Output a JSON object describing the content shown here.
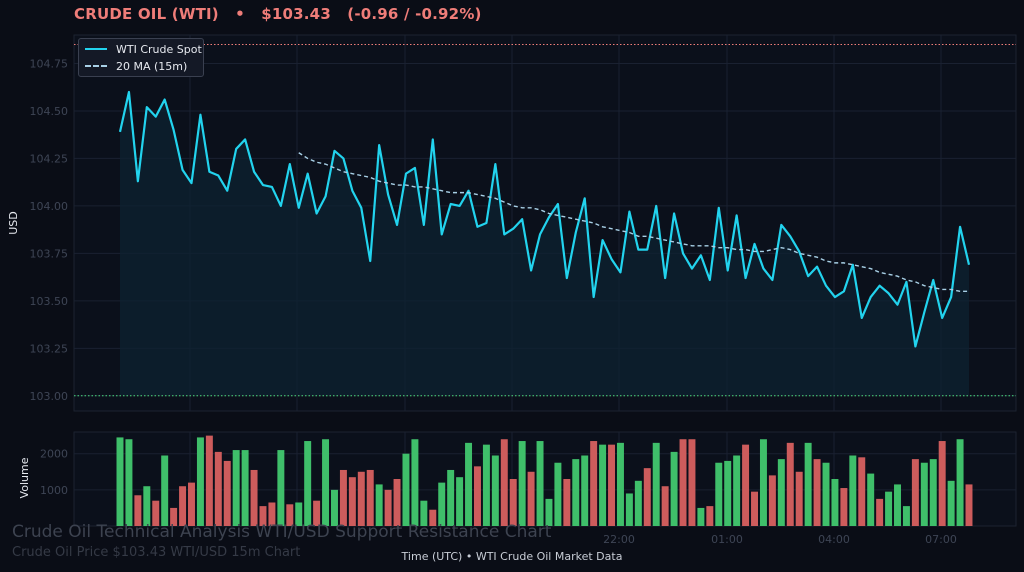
{
  "header": {
    "name": "CRUDE OIL (WTI)",
    "sep": "•",
    "price": "$103.43",
    "change": "(-0.96 / -0.92%)"
  },
  "watermark": {
    "title": "Crude Oil Technical Analysis WTI/USD Support Resistance Chart",
    "subtitle": "Crude Oil Price $103.43 WTI/USD 15m Chart"
  },
  "footer": {
    "text": "Time (UTC)  •  WTI Crude Oil Market Data"
  },
  "legend": {
    "spot": "WTI Crude Spot",
    "ma": "20 MA (15m)"
  },
  "colors": {
    "background": "#0a0d16",
    "price_line": "#22d3ee",
    "ma_line": "#a8d0e6",
    "resistance": "#ef7d79",
    "support": "#4ade80",
    "vol_up": "#3fbf6a",
    "vol_down": "#cd5c5c"
  },
  "chart_data": [
    {
      "type": "line",
      "ylabel": "USD",
      "ylim": [
        102.92,
        104.9
      ],
      "yticks": [
        103.0,
        103.25,
        103.5,
        103.75,
        104.0,
        104.25,
        104.5,
        104.75
      ],
      "ytick_labels": [
        "103.00",
        "103.25",
        "103.50",
        "103.75",
        "104.00",
        "104.25",
        "104.50",
        "104.75"
      ],
      "xticks_labels": [
        "22:00",
        "01:00",
        "04:00",
        "07:00"
      ],
      "resistance": 104.85,
      "support": 103.0,
      "grid": true,
      "legend_position": "top-left",
      "series": [
        {
          "name": "WTI Crude Spot",
          "values": [
            104.39,
            104.6,
            104.13,
            104.52,
            104.47,
            104.56,
            104.4,
            104.19,
            104.12,
            104.48,
            104.18,
            104.16,
            104.08,
            104.3,
            104.35,
            104.18,
            104.11,
            104.1,
            104.0,
            104.22,
            103.99,
            104.17,
            103.96,
            104.05,
            104.29,
            104.25,
            104.08,
            103.99,
            103.71,
            104.32,
            104.06,
            103.9,
            104.17,
            104.2,
            103.9,
            104.35,
            103.85,
            104.01,
            104.0,
            104.08,
            103.89,
            103.91,
            104.22,
            103.85,
            103.88,
            103.93,
            103.66,
            103.85,
            103.94,
            104.01,
            103.62,
            103.86,
            104.04,
            103.52,
            103.82,
            103.72,
            103.65,
            103.97,
            103.77,
            103.77,
            104.0,
            103.62,
            103.96,
            103.75,
            103.67,
            103.74,
            103.61,
            103.99,
            103.66,
            103.95,
            103.62,
            103.8,
            103.67,
            103.61,
            103.9,
            103.84,
            103.76,
            103.63,
            103.68,
            103.58,
            103.52,
            103.55,
            103.69,
            103.41,
            103.52,
            103.58,
            103.54,
            103.48,
            103.6,
            103.26,
            103.44,
            103.61,
            103.41,
            103.52,
            103.89,
            103.69
          ]
        },
        {
          "name": "20 MA (15m)",
          "values": [
            104.28,
            104.25,
            104.23,
            104.22,
            104.2,
            104.18,
            104.17,
            104.16,
            104.15,
            104.13,
            104.12,
            104.11,
            104.11,
            104.1,
            104.1,
            104.09,
            104.08,
            104.07,
            104.07,
            104.07,
            104.06,
            104.05,
            104.04,
            104.02,
            104.0,
            103.99,
            103.99,
            103.98,
            103.96,
            103.95,
            103.94,
            103.93,
            103.92,
            103.91,
            103.89,
            103.88,
            103.87,
            103.86,
            103.84,
            103.84,
            103.83,
            103.82,
            103.81,
            103.8,
            103.79,
            103.79,
            103.79,
            103.78,
            103.78,
            103.77,
            103.77,
            103.76,
            103.76,
            103.77,
            103.78,
            103.77,
            103.75,
            103.74,
            103.73,
            103.71,
            103.7,
            103.7,
            103.69,
            103.68,
            103.67,
            103.65,
            103.64,
            103.63,
            103.61,
            103.6,
            103.58,
            103.57,
            103.56,
            103.56,
            103.55,
            103.55
          ]
        }
      ]
    },
    {
      "type": "bar",
      "ylabel": "Volume",
      "ylim": [
        0,
        2600
      ],
      "yticks": [
        1000,
        2000
      ],
      "ytick_labels": [
        "1000",
        "2000"
      ],
      "values": [
        2450,
        2400,
        850,
        1100,
        700,
        1950,
        500,
        1100,
        1200,
        2450,
        2500,
        2050,
        1800,
        2100,
        2100,
        1550,
        550,
        650,
        2100,
        600,
        650,
        2350,
        700,
        2400,
        1000,
        1550,
        1350,
        1500,
        1550,
        1150,
        1000,
        1300,
        2000,
        2400,
        700,
        450,
        1200,
        1550,
        1350,
        2300,
        1650,
        2250,
        1950,
        2400,
        1300,
        2350,
        1500,
        2350,
        750,
        1750,
        1300,
        1850,
        1950,
        2350,
        2250,
        2250,
        2300,
        900,
        1250,
        1600,
        2300,
        1100,
        2050,
        2400,
        2400,
        500,
        550,
        1750,
        1800,
        1950,
        2250,
        950,
        2400,
        1400,
        1850,
        2300,
        1500,
        2300,
        1850,
        1750,
        1300,
        1050,
        1950,
        1900,
        1450,
        750,
        950,
        1150,
        550,
        1850,
        1750,
        1850,
        2350,
        1250,
        2400,
        1150
      ],
      "up": [
        1,
        1,
        0,
        1,
        0,
        1,
        0,
        0,
        0,
        1,
        0,
        0,
        0,
        1,
        1,
        0,
        0,
        0,
        1,
        0,
        1,
        1,
        0,
        1,
        1,
        0,
        0,
        0,
        0,
        1,
        0,
        0,
        1,
        1,
        1,
        0,
        1,
        1,
        1,
        1,
        0,
        1,
        1,
        0,
        0,
        1,
        0,
        1,
        1,
        1,
        0,
        1,
        1,
        0,
        1,
        0,
        1,
        1,
        1,
        0,
        1,
        0,
        1,
        0,
        0,
        1,
        0,
        1,
        1,
        1,
        0,
        0,
        1,
        0,
        1,
        0,
        0,
        1,
        0,
        1,
        1,
        0,
        1,
        0,
        1,
        0,
        1,
        1,
        1,
        0,
        1,
        1,
        0,
        1,
        1,
        0
      ]
    }
  ]
}
